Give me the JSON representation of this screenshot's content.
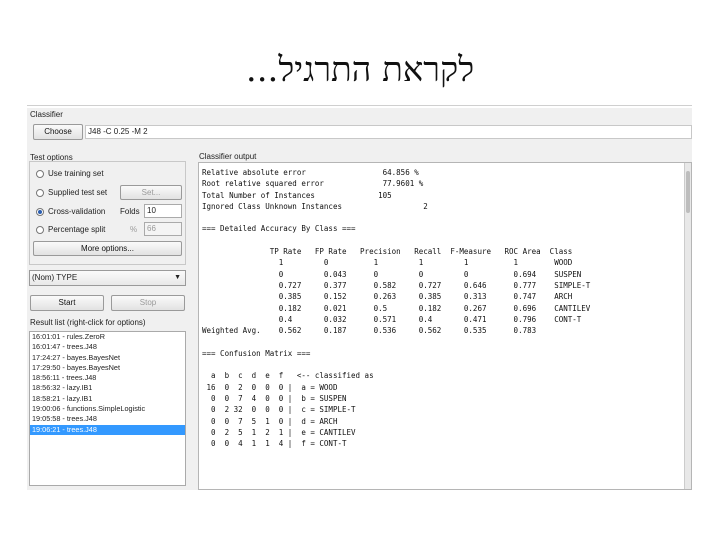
{
  "slide": {
    "title": "לקראת התרגיל..."
  },
  "classifier": {
    "section_label": "Classifier",
    "choose_label": "Choose",
    "classifier_text": "J48 -C 0.25 -M 2"
  },
  "test_options": {
    "section_label": "Test options",
    "use_training_set": "Use training set",
    "supplied_test_set": "Supplied test set",
    "set_label": "Set...",
    "cross_validation": "Cross-validation",
    "folds_label": "Folds",
    "folds_value": "10",
    "percentage_split": "Percentage split",
    "percent_label": "%",
    "percent_value": "66",
    "more_options": "More options...",
    "selected": "cross_validation"
  },
  "class_select": {
    "value": "(Nom) TYPE"
  },
  "controls": {
    "start_label": "Start",
    "stop_label": "Stop"
  },
  "result_list": {
    "label": "Result list (right-click for options)",
    "items": [
      "16:01:01 - rules.ZeroR",
      "16:01:47 - trees.J48",
      "17:24:27 - bayes.BayesNet",
      "17:29:50 - bayes.BayesNet",
      "18:56:11 - trees.J48",
      "18:56:32 - lazy.IB1",
      "18:58:21 - lazy.IB1",
      "19:00:06 - functions.SimpleLogistic",
      "19:05:58 - trees.J48",
      "19:06:21 - trees.J48"
    ],
    "selected_index": 9
  },
  "output": {
    "label": "Classifier output",
    "text": "Relative absolute error                 64.856 %\nRoot relative squared error             77.9601 %\nTotal Number of Instances              105\nIgnored Class Unknown Instances                  2\n\n=== Detailed Accuracy By Class ===\n\n               TP Rate   FP Rate   Precision   Recall  F-Measure   ROC Area  Class\n                 1         0          1         1         1          1        WOOD\n                 0         0.043      0         0         0          0.694    SUSPEN\n                 0.727     0.377      0.582     0.727     0.646      0.777    SIMPLE-T\n                 0.385     0.152      0.263     0.385     0.313      0.747    ARCH\n                 0.182     0.021      0.5       0.182     0.267      0.696    CANTILEV\n                 0.4       0.032      0.571     0.4       0.471      0.796    CONT-T\nWeighted Avg.    0.562     0.187      0.536     0.562     0.535      0.783\n\n=== Confusion Matrix ===\n\n  a  b  c  d  e  f   <-- classified as\n 16  0  2  0  0  0 |  a = WOOD\n  0  0  7  4  0  0 |  b = SUSPEN\n  0  2 32  0  0  0 |  c = SIMPLE-T\n  0  0  7  5  1  0 |  d = ARCH\n  0  2  5  1  2  1 |  e = CANTILEV\n  0  0  4  1  1  4 |  f = CONT-T"
  }
}
